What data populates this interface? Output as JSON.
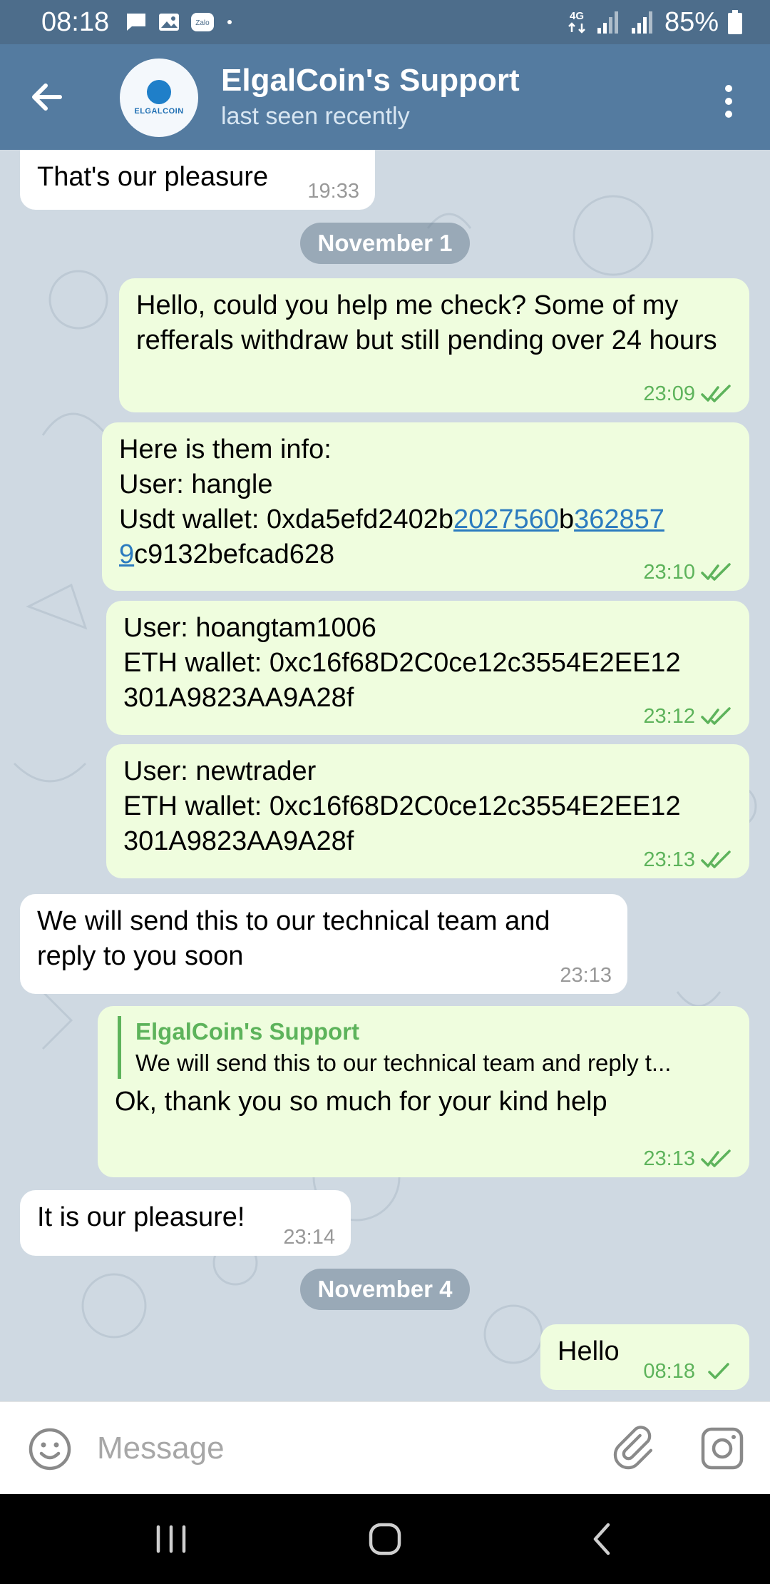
{
  "status_bar": {
    "time": "08:18",
    "network": "4G",
    "battery": "85%",
    "notification_icons": [
      "message-icon",
      "image-icon",
      "zalo-icon",
      "dot-icon"
    ]
  },
  "header": {
    "title": "ElgalCoin's Support",
    "subtitle": "last seen recently",
    "avatar_text": "ELGALCOIN"
  },
  "messages": [
    {
      "type": "in",
      "text": "That's our pleasure",
      "time": "19:33"
    },
    {
      "type": "date",
      "text": "November 1"
    },
    {
      "type": "out",
      "text": "Hello, could you help me check? Some of my refferals withdraw but still pending over 24 hours",
      "time": "23:09",
      "status": "read"
    },
    {
      "type": "out",
      "line1": "Here is them info:",
      "line2": "User: hangle",
      "wallet_prefix": "Usdt wallet: 0xda5efd2402b",
      "link1": "2027560",
      "mid": "b",
      "link2a": "362857",
      "link2b": "9",
      "wallet_suffix": "c9132befcad628",
      "time": "23:10",
      "status": "read"
    },
    {
      "type": "out",
      "line1": "User: hoangtam1006",
      "line2": "ETH wallet: 0xc16f68D2C0ce12c3554E2EE12",
      "line3": "301A9823AA9A28f",
      "time": "23:12",
      "status": "read"
    },
    {
      "type": "out",
      "line1": "User: newtrader",
      "line2": "ETH wallet: 0xc16f68D2C0ce12c3554E2EE12",
      "line3": "301A9823AA9A28f",
      "time": "23:13",
      "status": "read"
    },
    {
      "type": "in",
      "text": "We will send this to our technical team and reply to you soon",
      "time": "23:13"
    },
    {
      "type": "out",
      "reply_name": "ElgalCoin's Support",
      "reply_text": "We will send this to our technical team and reply t...",
      "text": "Ok, thank you so much for your kind help",
      "time": "23:13",
      "status": "read"
    },
    {
      "type": "in",
      "text": "It is our pleasure!",
      "time": "23:14"
    },
    {
      "type": "date",
      "text": "November 4"
    },
    {
      "type": "out",
      "text": "Hello",
      "time": "08:18",
      "status": "sent"
    }
  ],
  "input": {
    "placeholder": "Message",
    "value": ""
  },
  "colors": {
    "header": "#547ba0",
    "status_bar": "#4d6d8b",
    "outgoing_bubble": "#effdde",
    "incoming_bubble": "#ffffff",
    "accent_green": "#5db35b",
    "link": "#2b7bbf"
  }
}
